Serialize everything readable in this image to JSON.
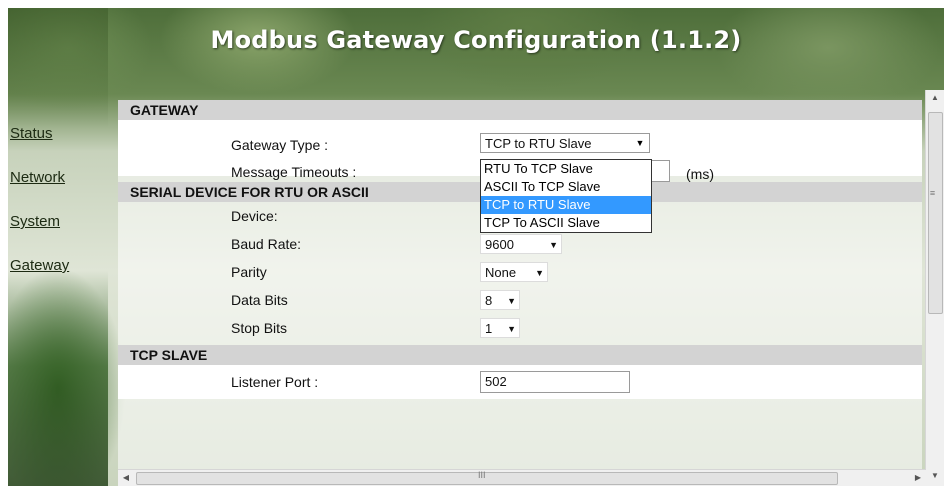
{
  "page": {
    "title": "Modbus Gateway Configuration (1.1.2)"
  },
  "nav": {
    "items": [
      "Status",
      "Network",
      "System",
      "Gateway"
    ]
  },
  "sections": {
    "gateway": "GATEWAY",
    "serial": "SERIAL DEVICE FOR RTU OR ASCII",
    "tcp": "TCP SLAVE"
  },
  "gateway": {
    "type_label": "Gateway Type :",
    "type_value": "TCP to RTU Slave",
    "type_options": [
      "RTU To TCP Slave",
      "ASCII To TCP Slave",
      "TCP to RTU Slave",
      "TCP To ASCII Slave"
    ],
    "timeouts_label": "Message Timeouts :",
    "timeouts_unit": "(ms)"
  },
  "serial": {
    "device_label": "Device:",
    "baud_label": "Baud Rate:",
    "baud_value": "9600",
    "parity_label": "Parity",
    "parity_value": "None",
    "databits_label": "Data Bits",
    "databits_value": "8",
    "stopbits_label": "Stop Bits",
    "stopbits_value": "1"
  },
  "tcp": {
    "port_label": "Listener Port :",
    "port_value": "502"
  },
  "scrollbar": {
    "h_grip": "III",
    "v_grip": "≡"
  }
}
